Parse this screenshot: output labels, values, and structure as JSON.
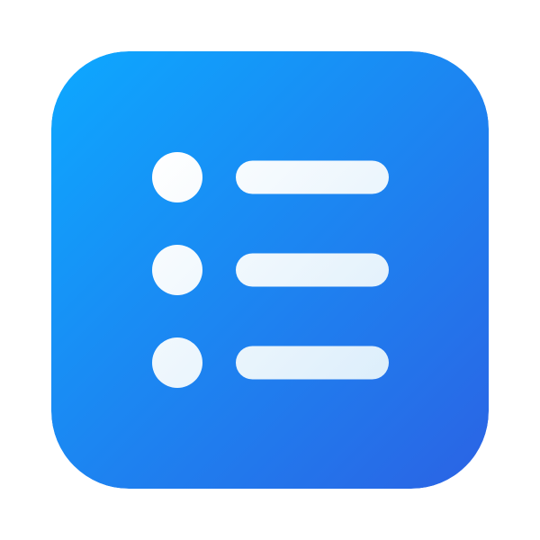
{
  "app_icon": {
    "icon": "list-icon",
    "gradient": {
      "start": "#0DA8FF",
      "end": "#2B63E4"
    },
    "glyph": {
      "start": "#FFFFFF",
      "end": "#DCEEFB"
    },
    "rows": [
      {
        "bullet": "bullet-dot-icon",
        "line": "list-line"
      },
      {
        "bullet": "bullet-dot-icon",
        "line": "list-line"
      },
      {
        "bullet": "bullet-dot-icon",
        "line": "list-line"
      }
    ]
  }
}
